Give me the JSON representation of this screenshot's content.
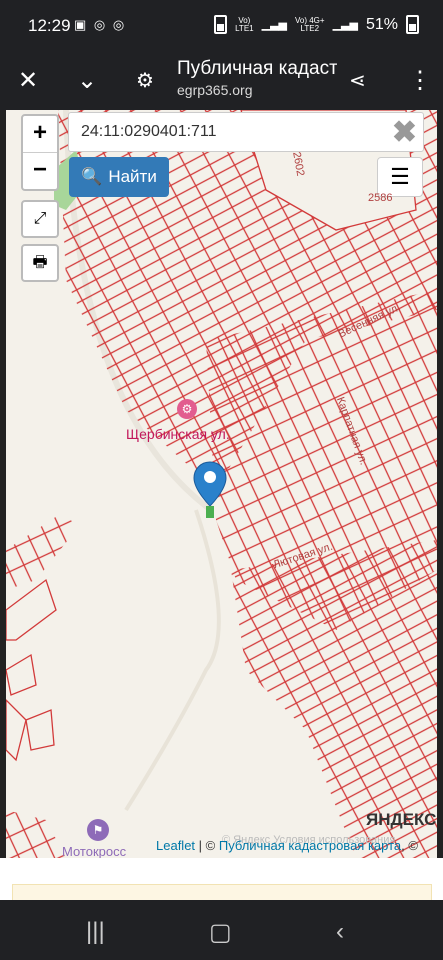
{
  "status": {
    "time": "12:29",
    "battery": "51%",
    "net1": "LTE1",
    "net2": "LTE2"
  },
  "browser": {
    "title": "Публичная кадастровая карта",
    "url": "egrp365.org"
  },
  "map": {
    "search_value": "24:11:0290401:711",
    "find_label": "Найти",
    "zoom_in": "+",
    "zoom_out": "−",
    "street_labels": [
      "Щербинская ул.",
      "Мотокросс",
      "2602",
      "2586",
      "Весенняя ул.",
      "Карпатная ул.",
      "Лютовая ул."
    ],
    "attribution_leaflet": "Leaflet",
    "attribution_sep": " | © ",
    "attribution_source": "Публичная кадастровая карта",
    "attribution_end": ", ©",
    "yandex": "ЯНДЕКС",
    "yandex_terms": "© Яндекс Условия использования"
  },
  "colors": {
    "parcel": "#d23a3a",
    "marker": "#2a81cb",
    "button": "#337ab7"
  }
}
